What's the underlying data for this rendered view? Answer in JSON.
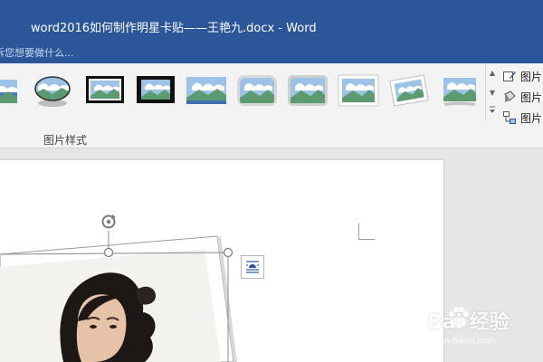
{
  "window": {
    "title": "word2016如何制作明星卡贴——王艳九.docx - Word",
    "tell_me_placeholder": "诉您想要做什么..."
  },
  "ribbon": {
    "group_label": "图片样式",
    "gallery_styles": [
      {
        "icon": "picture-style-simple-icon"
      },
      {
        "icon": "picture-style-oval-shadow-icon"
      },
      {
        "icon": "picture-style-thick-black-frame-icon"
      },
      {
        "icon": "picture-style-black-matte-icon"
      },
      {
        "icon": "picture-style-soft-edge-icon"
      },
      {
        "icon": "picture-style-rounded-icon"
      },
      {
        "icon": "picture-style-beveled-icon"
      },
      {
        "icon": "picture-style-white-frame-icon"
      },
      {
        "icon": "picture-style-rotated-white-icon"
      },
      {
        "icon": "picture-style-shadow-right-icon"
      }
    ],
    "side_commands": [
      {
        "label": "图片",
        "icon": "picture-border-icon"
      },
      {
        "label": "图片",
        "icon": "picture-effects-icon"
      },
      {
        "label": "图片",
        "icon": "picture-layout-icon"
      }
    ]
  },
  "watermark": {
    "brand": "Bai 经验",
    "url": "jingyan.baidu.com"
  },
  "colors": {
    "titlebar": "#2b579a",
    "ribbon": "#f3f3f3",
    "workspace": "#e6e6e6"
  }
}
